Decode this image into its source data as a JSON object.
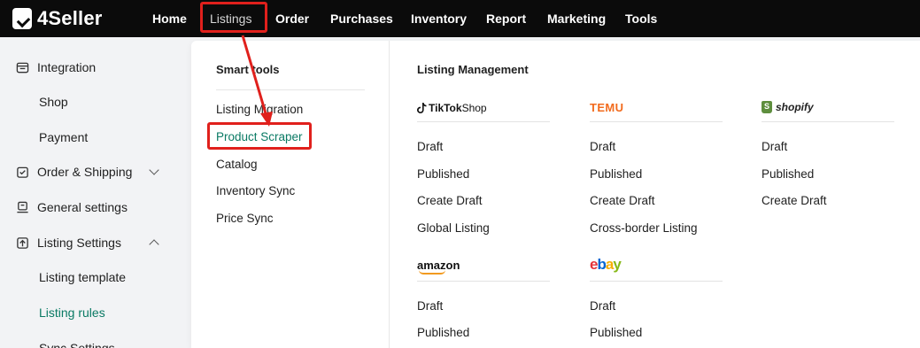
{
  "app": {
    "logo_text": "4Seller"
  },
  "nav": {
    "items": [
      {
        "label": "Home"
      },
      {
        "label": "Listings"
      },
      {
        "label": "Order"
      },
      {
        "label": "Purchases"
      },
      {
        "label": "Inventory"
      },
      {
        "label": "Report"
      },
      {
        "label": "Marketing"
      },
      {
        "label": "Tools"
      }
    ],
    "active": "Listings"
  },
  "sidebar": {
    "items": [
      {
        "label": "Integration",
        "icon": "integration-icon"
      },
      {
        "label": "Shop"
      },
      {
        "label": "Payment"
      },
      {
        "label": "Order & Shipping",
        "icon": "order-shipping-icon"
      },
      {
        "label": "General settings",
        "icon": "general-settings-icon"
      },
      {
        "label": "Listing Settings",
        "icon": "listing-settings-icon"
      },
      {
        "label": "Listing template"
      },
      {
        "label": "Listing rules"
      },
      {
        "label": "Sync Settings"
      }
    ],
    "selected": "Listing rules"
  },
  "smart_tools": {
    "title": "Smart tools",
    "items": [
      {
        "label": "Listing Migration"
      },
      {
        "label": "Product Scraper"
      },
      {
        "label": "Catalog"
      },
      {
        "label": "Inventory Sync"
      },
      {
        "label": "Price Sync"
      }
    ],
    "highlighted": "Product Scraper"
  },
  "listing_management": {
    "title": "Listing Management",
    "platforms": {
      "tiktok": {
        "logo_text": "TikTok",
        "logo_suffix": "Shop",
        "items": [
          "Draft",
          "Published",
          "Create Draft",
          "Global Listing"
        ]
      },
      "temu": {
        "logo_text": "TEMU",
        "items": [
          "Draft",
          "Published",
          "Create Draft",
          "Cross-border Listing"
        ]
      },
      "shopify": {
        "logo_text": "shopify",
        "items": [
          "Draft",
          "Published",
          "Create Draft"
        ]
      },
      "amazon": {
        "logo_text": "amazon",
        "items": [
          "Draft",
          "Published"
        ]
      },
      "ebay": {
        "logo_text": [
          "e",
          "b",
          "a",
          "y"
        ],
        "items": [
          "Draft",
          "Published"
        ]
      }
    }
  },
  "colors": {
    "accent": "#0a7a64",
    "annotation_red": "#e0201c",
    "nav_bg": "#0b0b0b",
    "temu_orange": "#f26b1d"
  }
}
